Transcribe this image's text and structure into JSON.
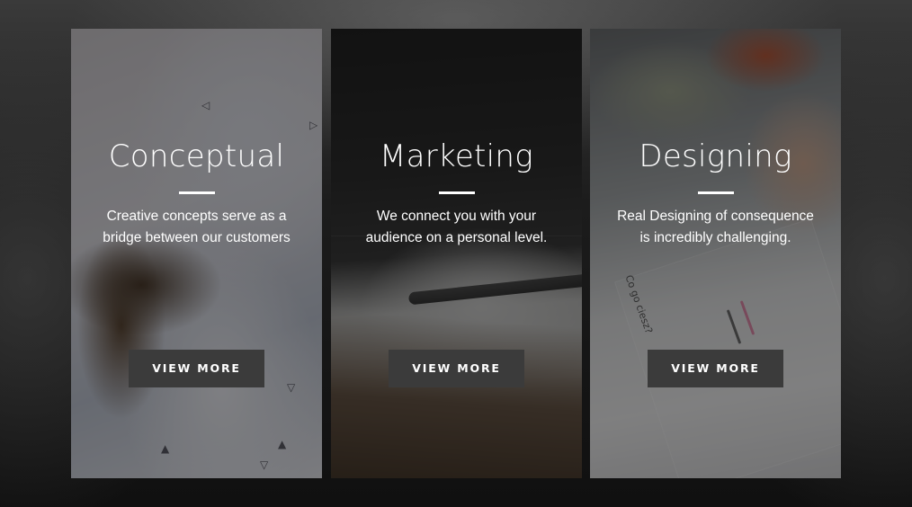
{
  "cards": [
    {
      "title": "Conceptual",
      "description": "Creative concepts serve as a bridge between our customers",
      "button_label": "VIEW MORE"
    },
    {
      "title": "Marketing",
      "description": "We connect you with your audience on a personal level.",
      "button_label": "VIEW MORE"
    },
    {
      "title": "Designing",
      "description": "Real Designing of consequence is incredibly challenging.",
      "button_label": "VIEW MORE"
    }
  ],
  "decor": {
    "card_2_pen_text": "",
    "card_3_paper_text": "Co go ciesz?"
  },
  "colors": {
    "button_bg": "#3b3b3b",
    "text": "#ffffff",
    "page_bg": "#1c1c1c"
  }
}
